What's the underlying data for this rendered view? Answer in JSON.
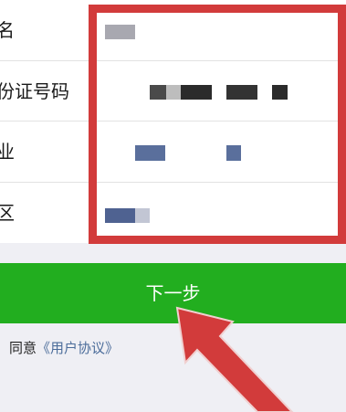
{
  "form": {
    "rows": [
      {
        "label": "名"
      },
      {
        "label": "份证号码"
      },
      {
        "label": "业"
      },
      {
        "label": "区"
      }
    ]
  },
  "next_button": {
    "label": "下一步"
  },
  "agreement": {
    "prefix": "同意",
    "link": "《用户协议》"
  },
  "colors": {
    "primary_button": "#22ae1f",
    "link": "#4b6c9a",
    "annotation": "#d23b3b"
  }
}
